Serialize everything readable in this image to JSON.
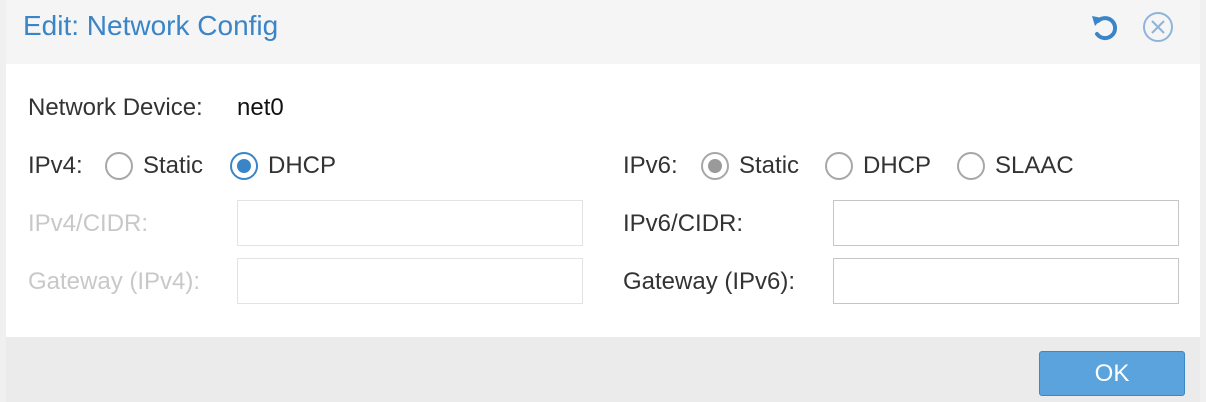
{
  "dialog": {
    "title": "Edit: Network Config",
    "icons": {
      "reset": "reset-icon",
      "close": "close-circle-icon"
    }
  },
  "form": {
    "network_device_label": "Network Device:",
    "network_device_value": "net0",
    "ipv4": {
      "label": "IPv4:",
      "options": [
        "Static",
        "DHCP"
      ],
      "selected": "DHCP",
      "cidr_label": "IPv4/CIDR:",
      "cidr_value": "",
      "gateway_label": "Gateway (IPv4):",
      "gateway_value": "",
      "fields_disabled": true
    },
    "ipv6": {
      "label": "IPv6:",
      "options": [
        "Static",
        "DHCP",
        "SLAAC"
      ],
      "selected": "Static",
      "cidr_label": "IPv6/CIDR:",
      "cidr_value": "",
      "gateway_label": "Gateway (IPv6):",
      "gateway_value": "",
      "fields_disabled": false
    }
  },
  "footer": {
    "ok_label": "OK"
  },
  "colors": {
    "accent": "#3a85c7",
    "button": "#5aa3dd",
    "disabled_text": "#c8c8c8"
  }
}
